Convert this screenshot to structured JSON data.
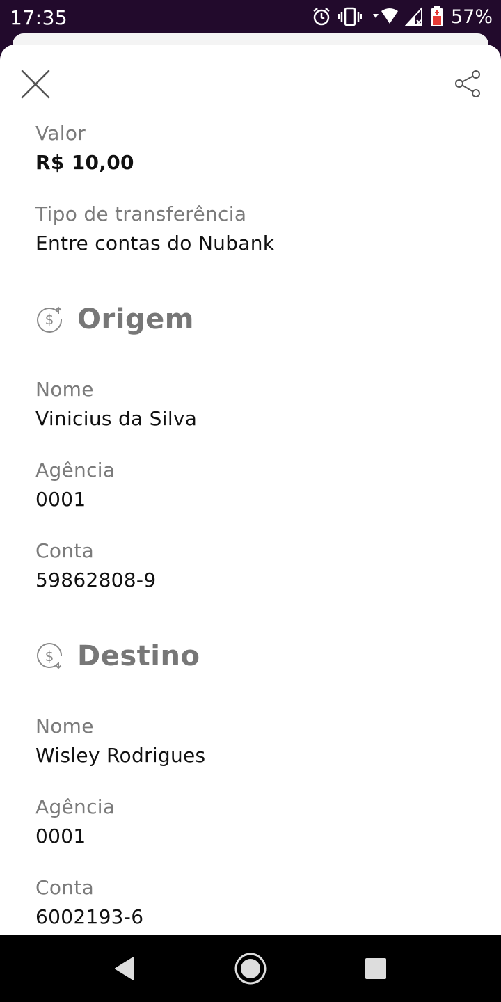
{
  "status_bar": {
    "time": "17:35",
    "battery": "57%",
    "icons": [
      "alarm-icon",
      "vibrate-icon",
      "wifi-icon",
      "signal-icon",
      "battery-icon"
    ]
  },
  "header": {
    "close_icon": "close-icon",
    "share_icon": "share-icon"
  },
  "transfer": {
    "value_label": "Valor",
    "value": "R$ 10,00",
    "type_label": "Tipo de transferência",
    "type": "Entre contas do Nubank"
  },
  "origin": {
    "title": "Origem",
    "icon": "money-out-icon",
    "name_label": "Nome",
    "name": "Vinicius da Silva",
    "agency_label": "Agência",
    "agency": "0001",
    "account_label": "Conta",
    "account": "59862808-9"
  },
  "destination": {
    "title": "Destino",
    "icon": "money-in-icon",
    "name_label": "Nome",
    "name": "Wisley Rodrigues",
    "agency_label": "Agência",
    "agency": "0001",
    "account_label": "Conta",
    "account": "6002193-6"
  },
  "nav_bar": {
    "icons": [
      "back-icon",
      "home-icon",
      "recents-icon"
    ]
  },
  "colors": {
    "status_bar_bg": "#220a2c",
    "label": "#7b7b7b",
    "value": "#111111",
    "section_title": "#777777"
  }
}
